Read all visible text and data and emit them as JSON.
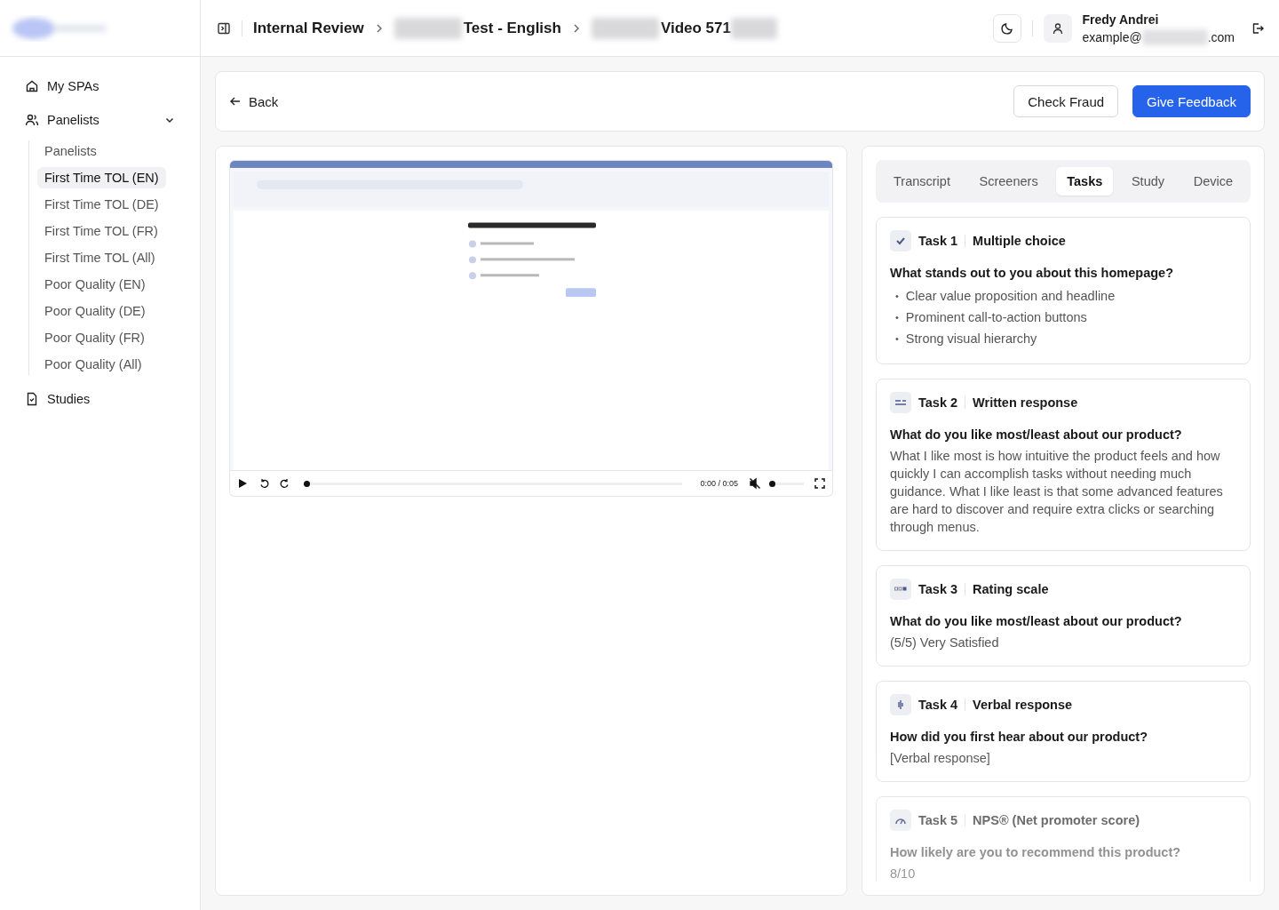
{
  "breadcrumbs": [
    {
      "label": "Internal Review",
      "redacted_before": false,
      "redacted_after": false
    },
    {
      "label": "Test - English",
      "redacted_before": true,
      "redacted_after": false
    },
    {
      "label": "Video 571",
      "redacted_before": true,
      "redacted_after": true
    }
  ],
  "user": {
    "name": "Fredy Andrei",
    "email_start": "example@",
    "email_end": ".com"
  },
  "sidebar": {
    "items": [
      {
        "label": "My SPAs",
        "kind": "home"
      },
      {
        "label": "Panelists",
        "kind": "people",
        "expanded": true,
        "children": [
          {
            "label": "Panelists",
            "selected": false
          },
          {
            "label": "First Time TOL (EN)",
            "selected": true
          },
          {
            "label": "First Time TOL (DE)",
            "selected": false
          },
          {
            "label": "First Time TOL (FR)",
            "selected": false
          },
          {
            "label": "First Time TOL (All)",
            "selected": false
          },
          {
            "label": "Poor Quality (EN)",
            "selected": false
          },
          {
            "label": "Poor Quality (DE)",
            "selected": false
          },
          {
            "label": "Poor Quality (FR)",
            "selected": false
          },
          {
            "label": "Poor Quality (All)",
            "selected": false
          }
        ]
      },
      {
        "label": "Studies",
        "kind": "file"
      }
    ]
  },
  "toolbar": {
    "back": "Back",
    "buttons": [
      {
        "label": "Check Fraud",
        "primary": false
      },
      {
        "label": "Give Feedback",
        "primary": true
      }
    ]
  },
  "video": {
    "kind": "picture",
    "time": "0:00 / 0:05",
    "muted": true,
    "progress": {
      "level": 0
    },
    "volume": {
      "level": 0
    }
  },
  "tabs": [
    {
      "label": "Transcript",
      "selected": false
    },
    {
      "label": "Screeners",
      "selected": false
    },
    {
      "label": "Tasks",
      "selected": true
    },
    {
      "label": "Study",
      "selected": false
    },
    {
      "label": "Device",
      "selected": false
    }
  ],
  "tasks": [
    {
      "kind": "choice",
      "number": "Task 1",
      "type": "Multiple choice",
      "question": "What stands out to you about this homepage?",
      "marker": "•",
      "answers": [
        "Clear value proposition and headline",
        "Prominent call-to-action buttons",
        "Strong visual hierarchy"
      ]
    },
    {
      "kind": "written",
      "number": "Task 2",
      "type": "Written response",
      "question": "What do you like most/least about our product?",
      "answer": "What I like most is how intuitive the product feels and how quickly I can accomplish tasks without needing much guidance. What I like least is that some advanced features are hard to discover and require extra clicks or searching through menus."
    },
    {
      "kind": "rating",
      "number": "Task 3",
      "type": "Rating scale",
      "question": "What do you like most/least about our product?",
      "answer": "(5/5) Very Satisfied"
    },
    {
      "kind": "verbal",
      "number": "Task 4",
      "type": "Verbal response",
      "question": "How did you first hear about our product?",
      "answer": "[Verbal response]"
    },
    {
      "kind": "nps",
      "number": "Task 5",
      "type": "NPS® (Net promoter score)",
      "question": "How likely are you to recommend this product?",
      "answer": "8/10"
    }
  ]
}
